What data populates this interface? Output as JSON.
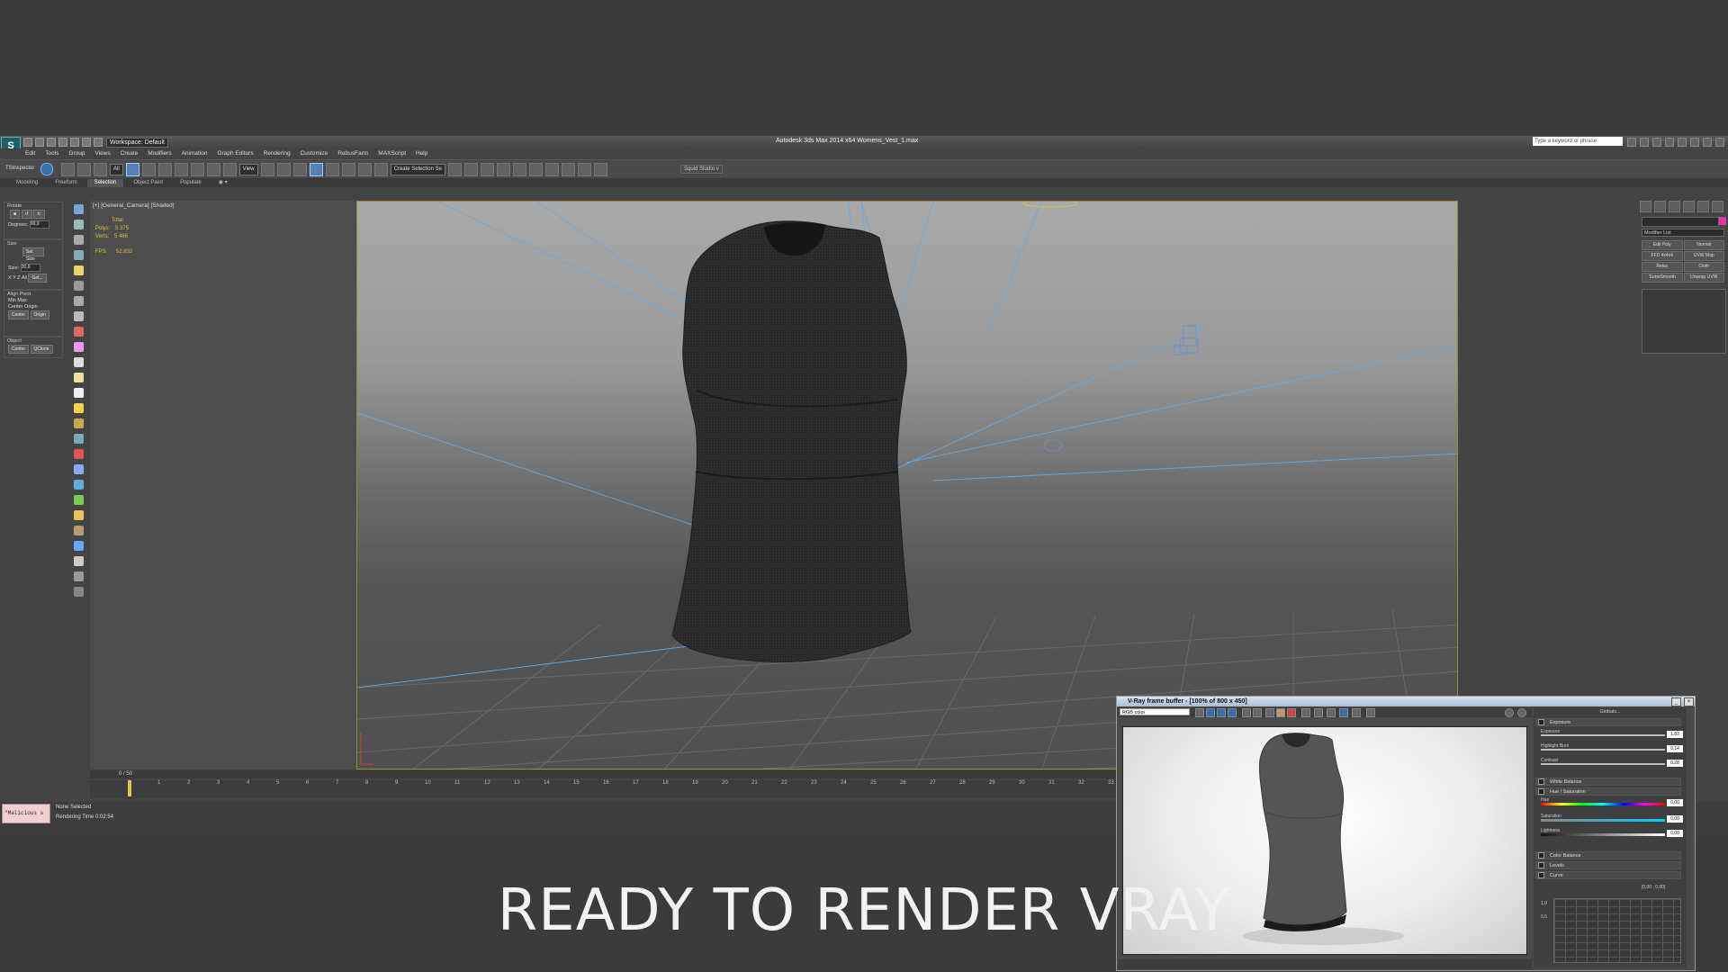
{
  "app": {
    "title": "Autodesk 3ds Max  2014 x64     Womens_Vest_1.max",
    "workspace": "Workspace: Default",
    "search_placeholder": "Type a keyword or phrase"
  },
  "menu": [
    "Edit",
    "Tools",
    "Group",
    "Views",
    "Create",
    "Modifiers",
    "Animation",
    "Graph Editors",
    "Rendering",
    "Customize",
    "RebusFarm",
    "MAXScript",
    "Help"
  ],
  "toolbar": {
    "ts_label": "TSInspector",
    "filter": "All",
    "view": "View",
    "selection_set": "Create Selection Se",
    "squid": "Squid Studio v"
  },
  "ribbon_tabs": [
    "Modeling",
    "Freeform",
    "Selection",
    "Object Paint",
    "Populate"
  ],
  "left_panel": {
    "rotate": "Rotate",
    "degrees_label": "Degrees:",
    "degrees_value": "90,0",
    "size": "Size",
    "set_size": "Set Size",
    "size_label": "Size:",
    "size_value": "20,0",
    "align_pivot": "Align Pivot",
    "min": "Min",
    "max": "Max",
    "center": "Center",
    "origin": "Origin",
    "object": "Object",
    "center_btn": "Center",
    "qclone": "QClone",
    "x": "X",
    "y": "Y",
    "z": "Z",
    "all": "All",
    "get": "Get..."
  },
  "viewport": {
    "label": "[+] [General_Camera] [Shaded]",
    "total": "Total",
    "polys_label": "Polys:",
    "polys": "5 375",
    "verts_label": "Verts:",
    "verts": "5 466",
    "fps_label": "FPS:",
    "fps": "52,832"
  },
  "command_panel": {
    "modifier_list": "Modifier List",
    "buttons": [
      "Edit Poly",
      "Normal",
      "FFD 4x4x4",
      "UVW Map",
      "Relax",
      "Cloth",
      "TurboSmooth",
      "Unwrap UVW"
    ]
  },
  "timeline": {
    "frame": "0 / 50",
    "ticks": [
      "0",
      "1",
      "2",
      "3",
      "4",
      "5",
      "6",
      "7",
      "8",
      "9",
      "10",
      "11",
      "12",
      "13",
      "14",
      "15",
      "16",
      "17",
      "18",
      "19",
      "20",
      "21",
      "22",
      "23",
      "24",
      "25",
      "26",
      "27",
      "28",
      "29",
      "30",
      "31",
      "32",
      "33"
    ]
  },
  "status": {
    "maxscript": "\"Malicious s",
    "selection": "None Selected",
    "render_time": "Rendering Time  0:02:54"
  },
  "vfb": {
    "title": "V-Ray frame buffer - [100% of 800 x 450]",
    "channel": "RGB color",
    "globals": "Globals...",
    "exposure": "Exposure",
    "exposure_lbl": "Exposure",
    "exposure_val": "1,83",
    "highlight_lbl": "Highlight Burn",
    "highlight_val": "0,14",
    "contrast_lbl": "Contrast",
    "contrast_val": "0,28",
    "white_balance": "White Balance",
    "hue_sat": "Hue / Saturation",
    "hue_lbl": "Hue",
    "hue_val": "0,00",
    "sat_lbl": "Saturation",
    "sat_val": "0,00",
    "light_lbl": "Lightness",
    "light_val": "0,00",
    "color_balance": "Color Balance",
    "levels": "Levels",
    "curve": "Curve",
    "curve_coords": "[0,00 ; 0,00]",
    "curve_y1": "1,0",
    "curve_y2": "0,5"
  },
  "caption": "READY TO RENDER VRAY"
}
